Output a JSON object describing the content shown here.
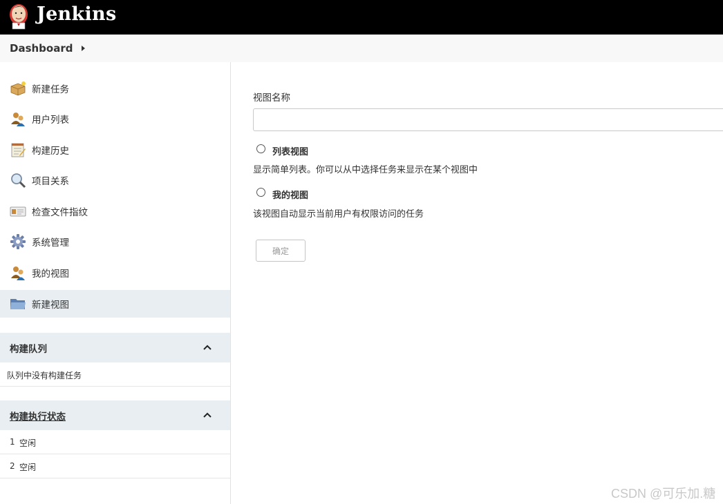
{
  "header": {
    "brand": "Jenkins",
    "logo_icon": "jenkins-butler-icon"
  },
  "breadcrumb": {
    "items": [
      "Dashboard"
    ],
    "separator_icon": "triangle-right-icon"
  },
  "sidebar": {
    "tasks": [
      {
        "label": "新建任务",
        "icon": "package-icon",
        "active": false
      },
      {
        "label": "用户列表",
        "icon": "users-icon",
        "active": false
      },
      {
        "label": "构建历史",
        "icon": "notepad-icon",
        "active": false
      },
      {
        "label": "项目关系",
        "icon": "magnifier-icon",
        "active": false
      },
      {
        "label": "检查文件指纹",
        "icon": "fingerprint-card-icon",
        "active": false
      },
      {
        "label": "系统管理",
        "icon": "gear-icon",
        "active": false
      },
      {
        "label": "我的视图",
        "icon": "users-icon",
        "active": false
      },
      {
        "label": "新建视图",
        "icon": "folder-icon",
        "active": true
      }
    ],
    "build_queue": {
      "title": "构建队列",
      "empty_text": "队列中没有构建任务",
      "toggle_icon": "chevron-up-icon"
    },
    "executors": {
      "title": "构建执行状态",
      "toggle_icon": "chevron-up-icon",
      "rows": [
        {
          "num": "1",
          "status": "空闲"
        },
        {
          "num": "2",
          "status": "空闲"
        }
      ]
    }
  },
  "main": {
    "view_name_label": "视图名称",
    "view_name_value": "",
    "options": [
      {
        "label": "列表视图",
        "description": "显示简单列表。你可以从中选择任务来显示在某个视图中",
        "selected": false
      },
      {
        "label": "我的视图",
        "description": "该视图自动显示当前用户有权限访问的任务",
        "selected": false
      }
    ],
    "ok_label": "确定"
  },
  "watermark": "CSDN @可乐加.糖"
}
